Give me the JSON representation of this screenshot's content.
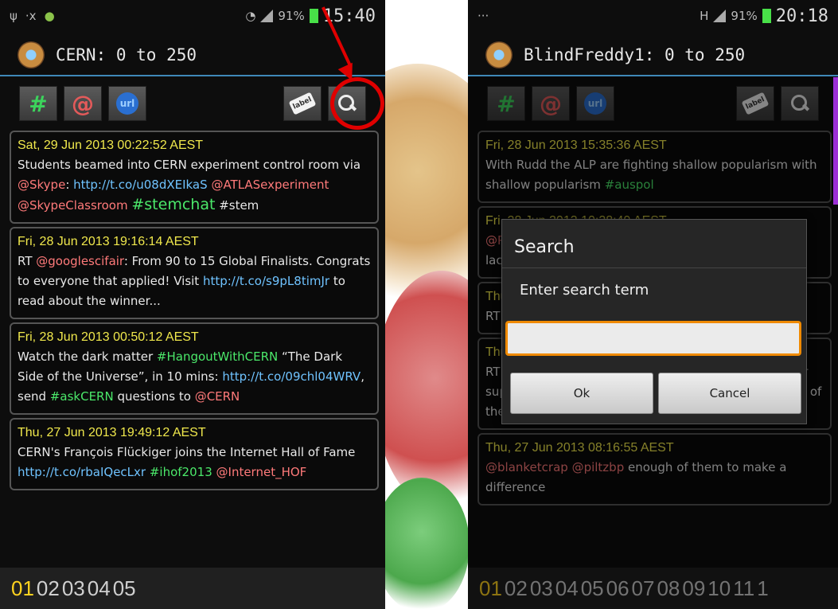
{
  "left": {
    "status_time": "15:40",
    "status_battery": "91%",
    "title": "CERN: 0 to 250",
    "tweets": [
      {
        "date": "Sat, 29 Jun 2013 00:22:52 AEST",
        "parts": [
          {
            "t": "text",
            "v": "Students beamed into CERN experiment control room via "
          },
          {
            "t": "at",
            "v": "@Skype"
          },
          {
            "t": "text",
            "v": ": "
          },
          {
            "t": "url",
            "v": "http://t.co/u08dXEIkaS"
          },
          {
            "t": "text",
            "v": " "
          },
          {
            "t": "at",
            "v": "@ATLASexperiment"
          },
          {
            "t": "text",
            "v": " "
          },
          {
            "t": "at",
            "v": "@SkypeClassroom"
          },
          {
            "t": "text",
            "v": " "
          },
          {
            "t": "hash",
            "v": "#stemchat"
          },
          {
            "t": "text",
            "v": " #stem"
          }
        ]
      },
      {
        "date": "Fri, 28 Jun 2013 19:16:14 AEST",
        "parts": [
          {
            "t": "text",
            "v": "RT "
          },
          {
            "t": "at",
            "v": "@googlescifair"
          },
          {
            "t": "text",
            "v": ": From 90 to 15 Global Finalists. Congrats to everyone that applied! Visit "
          },
          {
            "t": "url",
            "v": "http://t.co/s9pL8timJr"
          },
          {
            "t": "text",
            "v": " to read about the winner..."
          }
        ]
      },
      {
        "date": "Fri, 28 Jun 2013 00:50:12 AEST",
        "parts": [
          {
            "t": "text",
            "v": "Watch the dark matter "
          },
          {
            "t": "hash",
            "v": "#HangoutWithCERN"
          },
          {
            "t": "text",
            "v": " “The Dark Side of the Universe”, in 10 mins: "
          },
          {
            "t": "url",
            "v": "http://t.co/09chl04WRV"
          },
          {
            "t": "text",
            "v": ", send "
          },
          {
            "t": "hash",
            "v": "#askCERN"
          },
          {
            "t": "text",
            "v": " questions to "
          },
          {
            "t": "at",
            "v": "@CERN"
          }
        ]
      },
      {
        "date": "Thu, 27 Jun 2013 19:49:12 AEST",
        "parts": [
          {
            "t": "text",
            "v": "CERN's François Flückiger joins the Internet Hall of Fame "
          },
          {
            "t": "url",
            "v": "http://t.co/rbaIQecLxr"
          },
          {
            "t": "text",
            "v": " "
          },
          {
            "t": "hash",
            "v": "#ihof2013"
          },
          {
            "t": "text",
            "v": " "
          },
          {
            "t": "at",
            "v": "@Internet_HOF"
          }
        ]
      }
    ],
    "pages": [
      "01",
      "02",
      "03",
      "04",
      "05"
    ]
  },
  "right": {
    "status_time": "20:18",
    "status_battery": "91%",
    "title": "BlindFreddy1: 0 to 250",
    "tweets": [
      {
        "date": "Fri, 28 Jun 2013 15:35:36 AEST",
        "parts": [
          {
            "t": "text",
            "v": "With Rudd the ALP are fighting shallow popularism with shallow popularism "
          },
          {
            "t": "hash",
            "v": "#auspol"
          }
        ]
      },
      {
        "date": "Fri, 28 Jun 2013 10:38:49 AEST",
        "parts": [
          {
            "t": "at",
            "v": "@Pe"
          },
          {
            "t": "text",
            "v": " That's really a reflection on your 'intelligence' or lack of. You probably struggle with more "
          },
          {
            "t": "hash",
            "v": "#auspol"
          }
        ]
      },
      {
        "date": "Thu, 27 Jun 2013 19:42:13 AEST",
        "parts": [
          {
            "t": "text",
            "v": "RT "
          },
          {
            "t": "at",
            "v": "@"
          },
          {
            "t": "text",
            "v": " “"
          },
          {
            "t": "at",
            "v": "@P"
          },
          {
            "t": "text",
            "v": " pare"
          }
        ]
      },
      {
        "date": "Thu, 27 Jun 2013 11:51:02 AEST",
        "parts": [
          {
            "t": "text",
            "v": "RT "
          },
          {
            "t": "at",
            "v": "@virag064"
          },
          {
            "t": "text",
            "v": ": Slipper links Hockey to "
          },
          {
            "t": "hash",
            "v": "#Ashby"
          },
          {
            "t": "text",
            "v": " Palmer supports the facts "
          },
          {
            "t": "url",
            "v": "http://t.co/2zT2oC0sIj"
          },
          {
            "t": "text",
            "v": " The duplicity of the Coalition "
          },
          {
            "t": "hash",
            "v": "#auspol"
          },
          {
            "t": "text",
            "v": " "
          },
          {
            "t": "hash",
            "v": "#dupli..."
          }
        ]
      },
      {
        "date": "Thu, 27 Jun 2013 08:16:55 AEST",
        "parts": [
          {
            "t": "at",
            "v": "@blanketcrap"
          },
          {
            "t": "text",
            "v": " "
          },
          {
            "t": "at",
            "v": "@piltzbp"
          },
          {
            "t": "text",
            "v": " enough of them to make a difference"
          }
        ]
      }
    ],
    "pages": [
      "01",
      "02",
      "03",
      "04",
      "05",
      "06",
      "07",
      "08",
      "09",
      "10",
      "11",
      "1"
    ]
  },
  "toolbar": {
    "hash_label": "#",
    "at_label": "@",
    "url_label": "url",
    "label_tag": "label"
  },
  "dialog": {
    "title": "Search",
    "message": "Enter search term",
    "input_value": "",
    "ok_label": "Ok",
    "cancel_label": "Cancel"
  },
  "colors": {
    "date": "#f0e84c",
    "mention": "#ff7a7a",
    "url": "#6fc3ff",
    "hashtag": "#4be86a",
    "active_page": "#ffd21f",
    "highlight": "#e00000",
    "input_focus": "#f08a00"
  }
}
